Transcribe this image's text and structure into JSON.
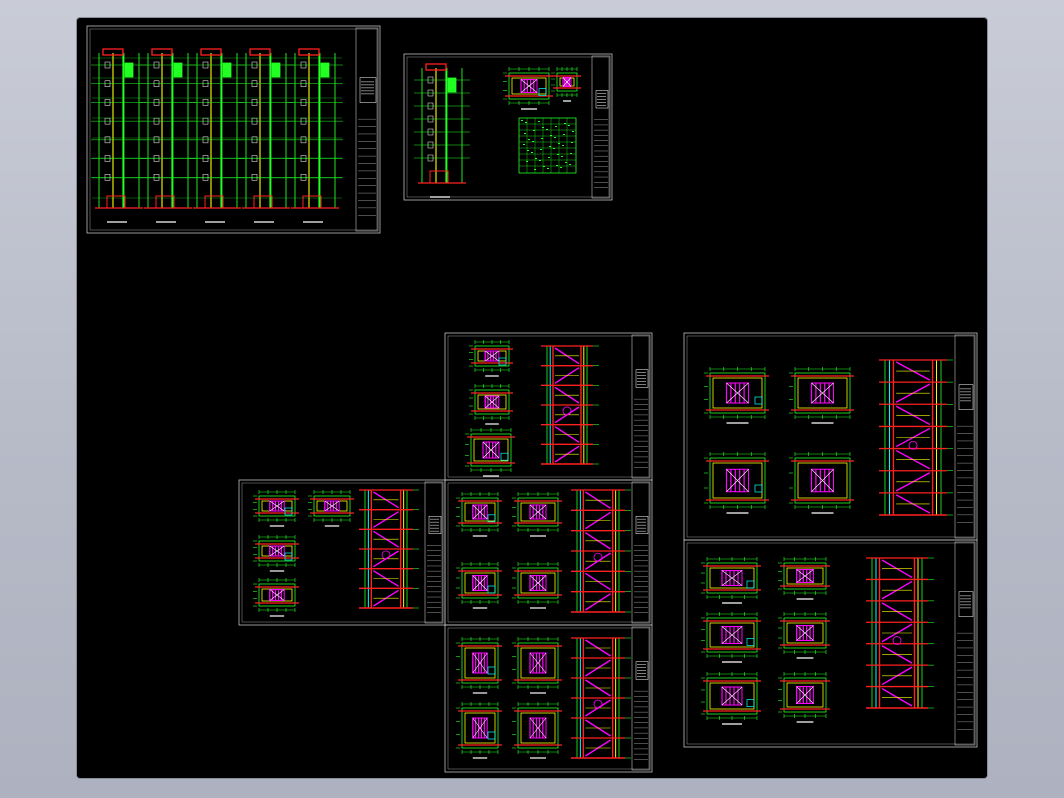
{
  "viewer": {
    "background": "#000000",
    "frame_color": "#bfbfbf",
    "colors": {
      "green": "#22ff22",
      "yellow": "#ffff00",
      "red": "#ff2020",
      "magenta": "#ff00ff",
      "cyan": "#00ffff",
      "white": "#ffffff"
    }
  },
  "sheets": [
    {
      "id": "sheet-elevator-sections",
      "kind": "elevator-sections"
    },
    {
      "id": "sheet-elevator-detail",
      "kind": "elevator-detail"
    },
    {
      "id": "sheet-stair-a",
      "kind": "stair"
    },
    {
      "id": "sheet-stair-b",
      "kind": "stair"
    },
    {
      "id": "sheet-stair-c",
      "kind": "stair"
    },
    {
      "id": "sheet-stair-d",
      "kind": "stair"
    },
    {
      "id": "sheet-stair-e",
      "kind": "stair"
    },
    {
      "id": "sheet-stair-f",
      "kind": "stair"
    }
  ]
}
